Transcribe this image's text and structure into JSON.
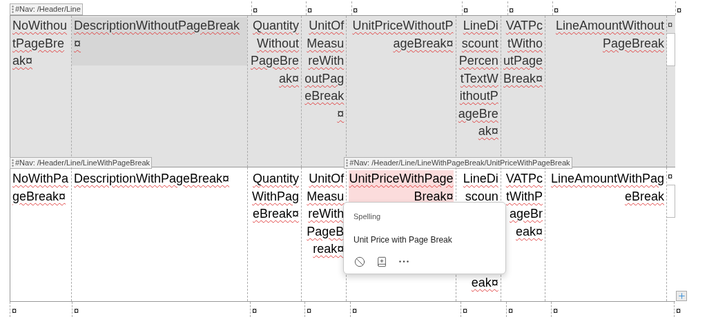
{
  "above_row": {
    "nav_tag": "#Nav: /Header/Line",
    "marks": [
      "¤",
      "¤",
      "¤",
      "¤",
      "¤",
      "¤",
      "¤"
    ]
  },
  "rows": [
    {
      "shaded": true,
      "end_mark": "¤",
      "cells": [
        {
          "text": "NoWithoutPageBreak¤"
        },
        {
          "text": "DescriptionWithoutPageBreak¤",
          "shaded": true
        },
        {
          "text": "QuantityWithoutPageBreak¤"
        },
        {
          "text": "UnitOfMeasureWithoutPageBreak¤"
        },
        {
          "text": "UnitPriceWithoutPageBreak¤"
        },
        {
          "text": "LineDiscountPercentTextWithoutPageBreak¤"
        },
        {
          "text": "VATPctWithoutPageBreak¤"
        },
        {
          "text": "LineAmountWithoutPageBreak"
        }
      ]
    },
    {
      "shaded": false,
      "end_mark": "¤",
      "cells": [
        {
          "text": "NoWithPageBreak¤",
          "nav_tag": "#Nav: /Header/Line/LineWithPageBreak"
        },
        {
          "text": "DescriptionWithPageBreak¤"
        },
        {
          "text": "QuantityWithPageBreak¤"
        },
        {
          "text": "UnitOfMeasureWithPageBreak¤"
        },
        {
          "text": "UnitPriceWithPageBreak¤",
          "flagged": true,
          "nav_tag": "#Nav: /Header/Line/LineWithPageBreak/UnitPriceWithPageBreak"
        },
        {
          "parts": [
            "LineDiscoun",
            "eak¤"
          ]
        },
        {
          "text": "VATPctWithPageBreak¤"
        },
        {
          "text": "LineAmountWithPageBreak"
        }
      ]
    }
  ],
  "below_marks": [
    "¤",
    "¤",
    "¤",
    "¤",
    "¤",
    "¤",
    "¤",
    "¤",
    "¤"
  ],
  "spelling_popup": {
    "title": "Spelling",
    "suggestion": "Unit Price with Page Break"
  }
}
